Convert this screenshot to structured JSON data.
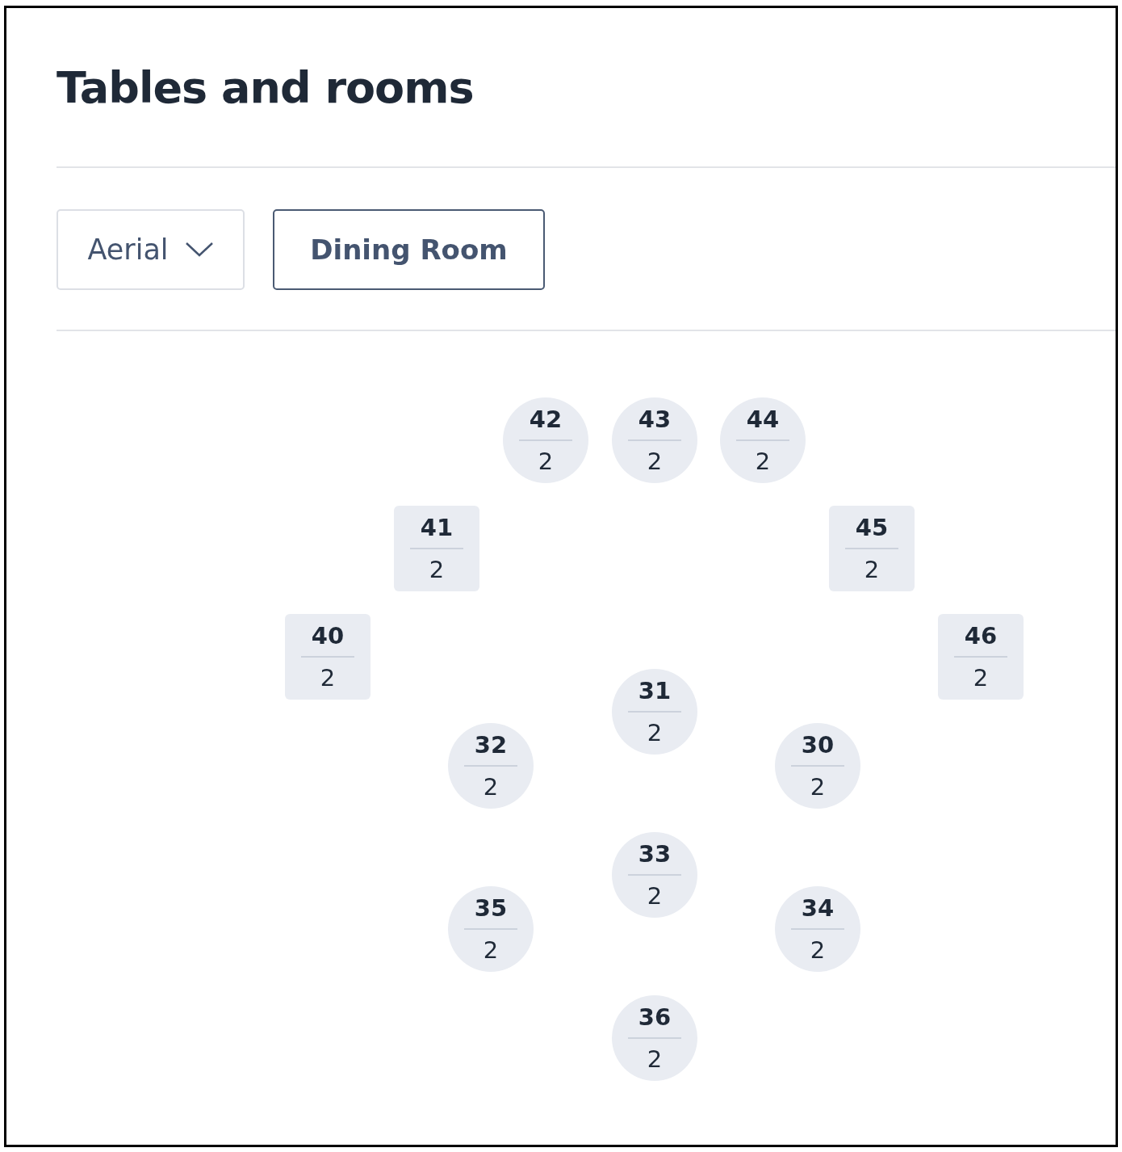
{
  "title": "Tables and rooms",
  "view_dropdown": {
    "value": "Aerial"
  },
  "room_button": {
    "label": "Dining Room"
  },
  "tables": [
    {
      "number": "42",
      "seats": "2",
      "kind": "round"
    },
    {
      "number": "43",
      "seats": "2",
      "kind": "round"
    },
    {
      "number": "44",
      "seats": "2",
      "kind": "round"
    },
    {
      "number": "41",
      "seats": "2",
      "kind": "square"
    },
    {
      "number": "45",
      "seats": "2",
      "kind": "square"
    },
    {
      "number": "40",
      "seats": "2",
      "kind": "square"
    },
    {
      "number": "46",
      "seats": "2",
      "kind": "square"
    },
    {
      "number": "31",
      "seats": "2",
      "kind": "round"
    },
    {
      "number": "32",
      "seats": "2",
      "kind": "round"
    },
    {
      "number": "30",
      "seats": "2",
      "kind": "round"
    },
    {
      "number": "33",
      "seats": "2",
      "kind": "round"
    },
    {
      "number": "35",
      "seats": "2",
      "kind": "round"
    },
    {
      "number": "34",
      "seats": "2",
      "kind": "round"
    },
    {
      "number": "36",
      "seats": "2",
      "kind": "round"
    }
  ]
}
